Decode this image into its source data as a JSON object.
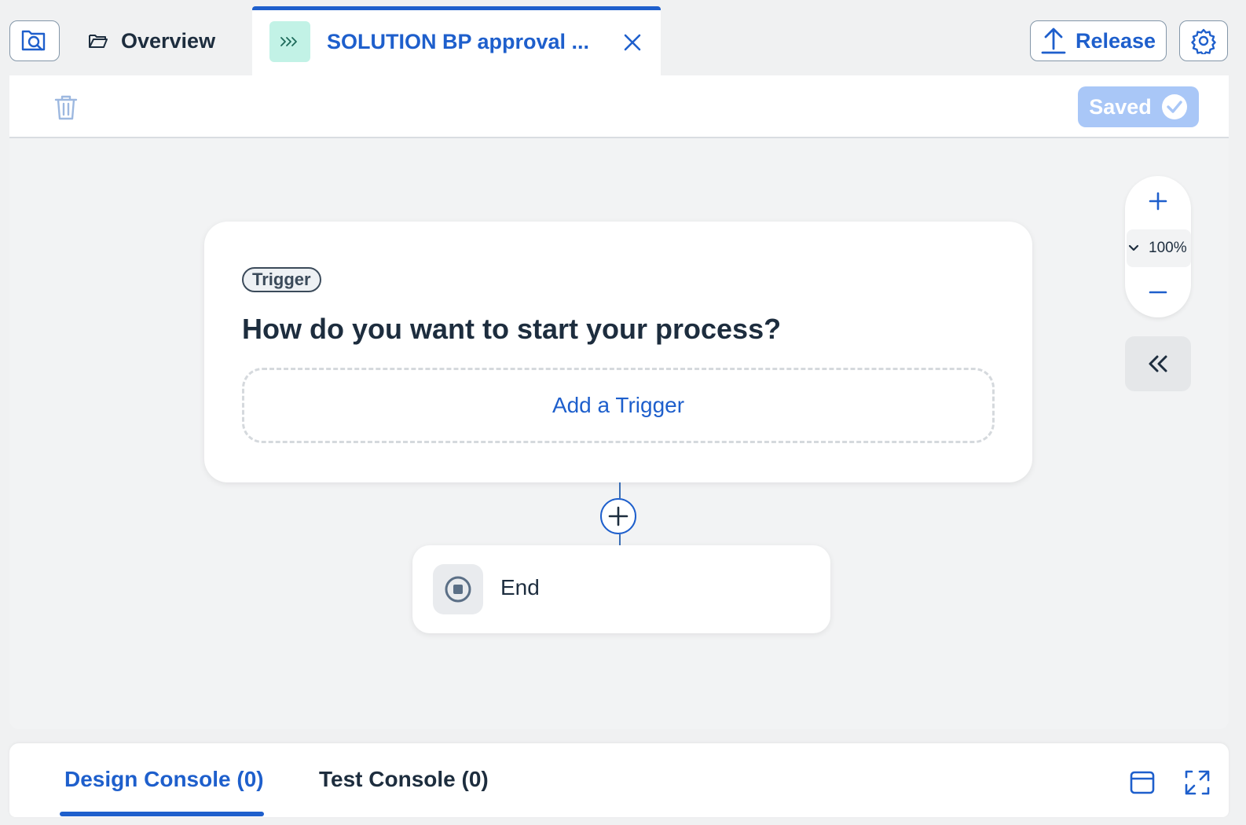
{
  "tabs": {
    "overview_label": "Overview",
    "active_label": "SOLUTION BP approval ..."
  },
  "header": {
    "release_label": "Release"
  },
  "toolbar": {
    "saved_label": "Saved"
  },
  "zoom": {
    "level": "100%"
  },
  "trigger_card": {
    "badge": "Trigger",
    "title": "How do you want to start your process?",
    "add_label": "Add a Trigger"
  },
  "end_card": {
    "label": "End"
  },
  "console": {
    "design_tab": "Design Console (0)",
    "test_tab": "Test Console (0)"
  },
  "colors": {
    "accent": "#1e5fcc",
    "saved_bg": "#a9c7f7",
    "process_icon_bg": "#c2f2e6"
  },
  "icons": [
    "search-icon",
    "folder-icon",
    "process-icon",
    "close-icon",
    "upload-icon",
    "gear-icon",
    "trash-icon",
    "checkmark-icon",
    "zoom-in-icon",
    "chevron-down-icon",
    "zoom-out-icon",
    "double-chevron-left-icon",
    "plus-circle-icon",
    "stop-icon",
    "panel-icon",
    "expand-icon"
  ]
}
